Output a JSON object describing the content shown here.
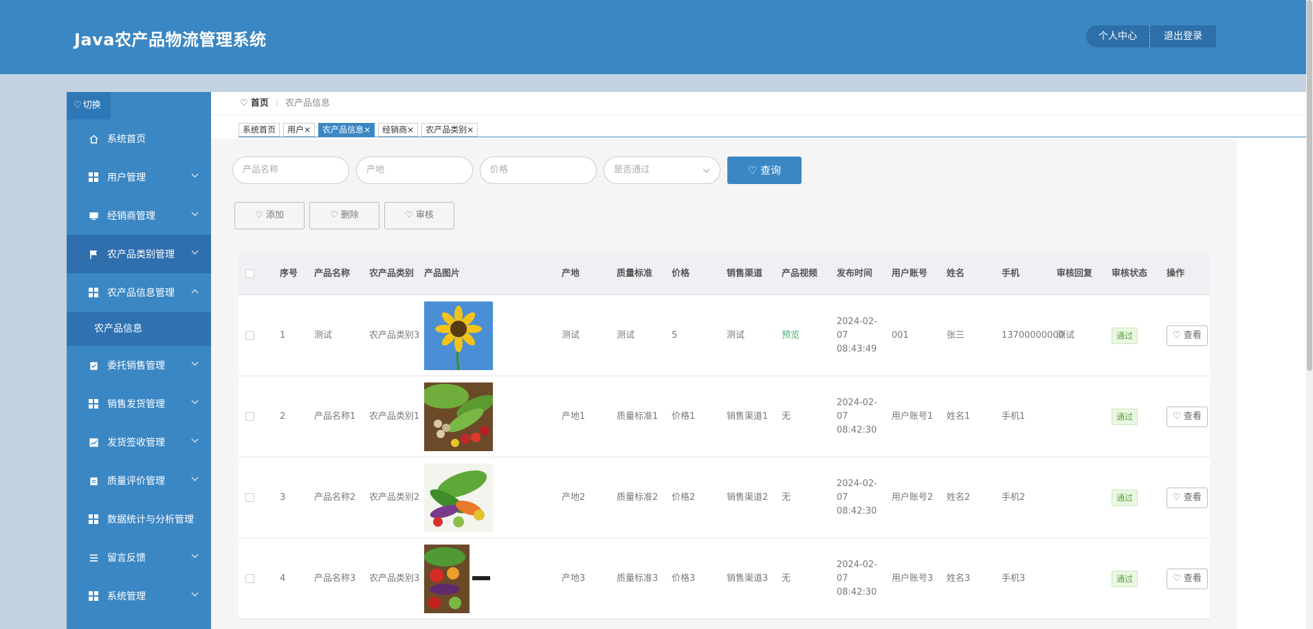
{
  "app": {
    "title": "Java农产品物流管理系统"
  },
  "header": {
    "profile_label": "个人中心",
    "logout_label": "退出登录"
  },
  "sidebar": {
    "toggle_label": "切换",
    "items": [
      {
        "label": "系统首页",
        "icon": "home-icon"
      },
      {
        "label": "用户管理",
        "icon": "grid-icon",
        "expandable": true
      },
      {
        "label": "经销商管理",
        "icon": "monitor-icon",
        "expandable": true
      },
      {
        "label": "农产品类别管理",
        "icon": "flag-icon",
        "expandable": true,
        "active": true
      },
      {
        "label": "农产品信息管理",
        "icon": "grid-icon",
        "expandable": true,
        "expanded": true
      },
      {
        "label": "委托销售管理",
        "icon": "clipboard-check-icon",
        "expandable": true
      },
      {
        "label": "销售发货管理",
        "icon": "grid-icon",
        "expandable": true
      },
      {
        "label": "发货签收管理",
        "icon": "chart-icon",
        "expandable": true
      },
      {
        "label": "质量评价管理",
        "icon": "clipboard-icon",
        "expandable": true
      },
      {
        "label": "数据统计与分析管理",
        "icon": "grid-icon"
      },
      {
        "label": "留言反馈",
        "icon": "list-icon",
        "expandable": true
      },
      {
        "label": "系统管理",
        "icon": "grid-icon",
        "expandable": true
      }
    ],
    "submenu": {
      "label": "农产品信息"
    }
  },
  "breadcrumb": {
    "home": "首页",
    "current": "农产品信息"
  },
  "tabs": [
    {
      "label": "系统首页",
      "closable": false
    },
    {
      "label": "用户",
      "closable": true
    },
    {
      "label": "农产品信息",
      "closable": true,
      "active": true
    },
    {
      "label": "经销商",
      "closable": true
    },
    {
      "label": "农产品类别",
      "closable": true
    }
  ],
  "search": {
    "name_placeholder": "产品名称",
    "origin_placeholder": "产地",
    "price_placeholder": "价格",
    "approved_placeholder": "是否通过",
    "query_label": "查询"
  },
  "actions": {
    "add_label": "添加",
    "delete_label": "删除",
    "review_label": "审核"
  },
  "table": {
    "headers": [
      "序号",
      "产品名称",
      "农产品类别",
      "产品图片",
      "产地",
      "质量标准",
      "价格",
      "销售渠道",
      "产品视频",
      "发布时间",
      "用户账号",
      "姓名",
      "手机",
      "审核回复",
      "审核状态",
      "操作"
    ],
    "rows": [
      {
        "idx": "1",
        "name": "测试",
        "category": "农产品类别3",
        "image": "sunflower",
        "origin": "测试",
        "quality": "测试",
        "price": "5",
        "channel": "测试",
        "video": "预览",
        "time": "2024-02-07 08:43:49",
        "account": "001",
        "uname": "张三",
        "phone": "13700000000",
        "reply": "测试",
        "status": "通过",
        "op": "查看"
      },
      {
        "idx": "2",
        "name": "产品名称1",
        "category": "农产品类别1",
        "image": "vegetables-cucumber",
        "origin": "产地1",
        "quality": "质量标准1",
        "price": "价格1",
        "channel": "销售渠道1",
        "video": "无",
        "time": "2024-02-07 08:42:30",
        "account": "用户账号1",
        "uname": "姓名1",
        "phone": "手机1",
        "reply": "",
        "status": "通过",
        "op": "查看"
      },
      {
        "idx": "3",
        "name": "产品名称2",
        "category": "农产品类别2",
        "image": "vegetables-mixed",
        "origin": "产地2",
        "quality": "质量标准2",
        "price": "价格2",
        "channel": "销售渠道2",
        "video": "无",
        "time": "2024-02-07 08:42:30",
        "account": "用户账号2",
        "uname": "姓名2",
        "phone": "手机2",
        "reply": "",
        "status": "通过",
        "op": "查看"
      },
      {
        "idx": "4",
        "name": "产品名称3",
        "category": "农产品类别3",
        "image": "vegetables-basket",
        "origin": "产地3",
        "quality": "质量标准3",
        "price": "价格3",
        "channel": "销售渠道3",
        "video": "无",
        "time": "2024-02-07 08:42:30",
        "account": "用户账号3",
        "uname": "姓名3",
        "phone": "手机3",
        "reply": "",
        "status": "通过",
        "op": "查看"
      }
    ]
  },
  "colors": {
    "primary": "#3b87c4",
    "primary_dark": "#2f6fae",
    "success": "#5aa53a"
  }
}
